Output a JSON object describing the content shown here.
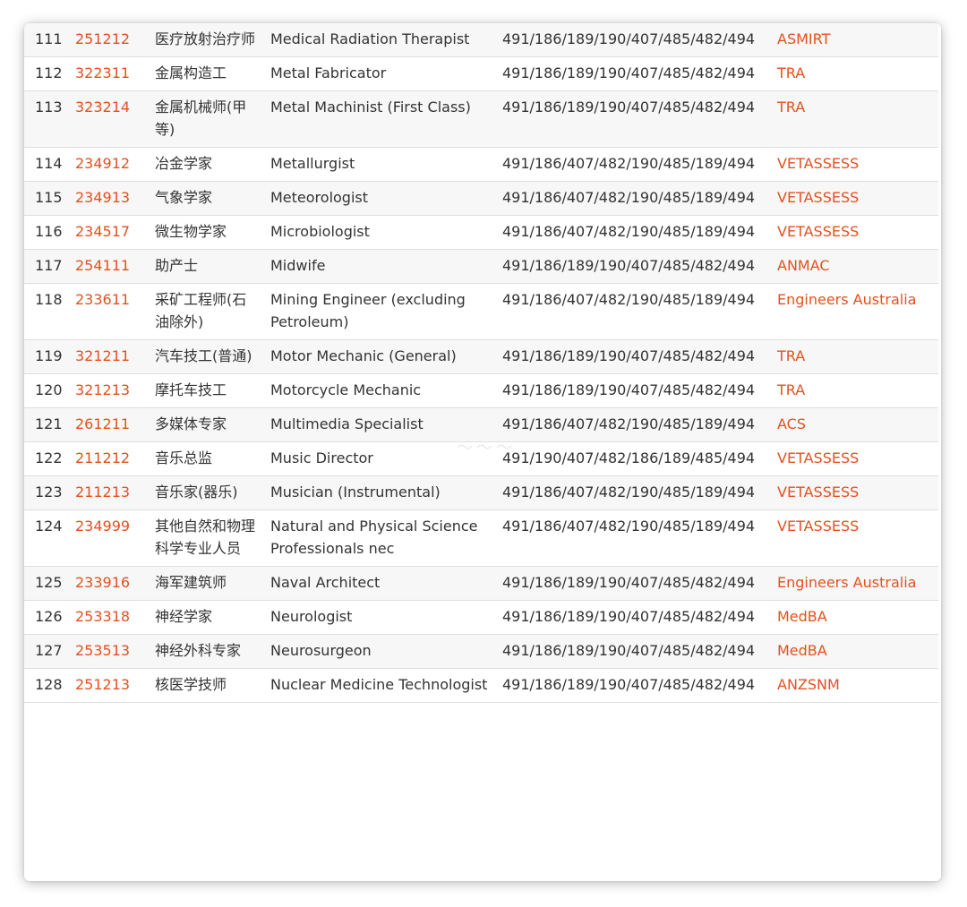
{
  "table": {
    "rows": [
      {
        "idx": "111",
        "code": "251212",
        "cn": "医疗放射治疗师",
        "en": "Medical Radiation Therapist",
        "visa": "491/186/189/190/407/485/482/494",
        "authority": "ASMIRT"
      },
      {
        "idx": "112",
        "code": "322311",
        "cn": "金属构造工",
        "en": "Metal Fabricator",
        "visa": "491/186/189/190/407/485/482/494",
        "authority": "TRA"
      },
      {
        "idx": "113",
        "code": "323214",
        "cn": "金属机械师(甲等)",
        "en": "Metal Machinist (First Class)",
        "visa": "491/186/189/190/407/485/482/494",
        "authority": "TRA"
      },
      {
        "idx": "114",
        "code": "234912",
        "cn": "冶金学家",
        "en": "Metallurgist",
        "visa": "491/186/407/482/190/485/189/494",
        "authority": "VETASSESS"
      },
      {
        "idx": "115",
        "code": "234913",
        "cn": "气象学家",
        "en": "Meteorologist",
        "visa": "491/186/407/482/190/485/189/494",
        "authority": "VETASSESS"
      },
      {
        "idx": "116",
        "code": "234517",
        "cn": "微生物学家",
        "en": "Microbiologist",
        "visa": "491/186/407/482/190/485/189/494",
        "authority": "VETASSESS"
      },
      {
        "idx": "117",
        "code": "254111",
        "cn": "助产士",
        "en": "Midwife",
        "visa": "491/186/189/190/407/485/482/494",
        "authority": "ANMAC"
      },
      {
        "idx": "118",
        "code": "233611",
        "cn": "采矿工程师(石油除外)",
        "en": "Mining Engineer (excluding Petroleum)",
        "visa": "491/186/407/482/190/485/189/494",
        "authority": "Engineers Australia"
      },
      {
        "idx": "119",
        "code": "321211",
        "cn": "汽车技工(普通)",
        "en": "Motor Mechanic (General)",
        "visa": "491/186/189/190/407/485/482/494",
        "authority": "TRA"
      },
      {
        "idx": "120",
        "code": "321213",
        "cn": "摩托车技工",
        "en": "Motorcycle Mechanic",
        "visa": "491/186/189/190/407/485/482/494",
        "authority": "TRA"
      },
      {
        "idx": "121",
        "code": "261211",
        "cn": "多媒体专家",
        "en": "Multimedia Specialist",
        "visa": "491/186/407/482/190/485/189/494",
        "authority": "ACS"
      },
      {
        "idx": "122",
        "code": "211212",
        "cn": "音乐总监",
        "en": "Music Director",
        "visa": "491/190/407/482/186/189/485/494",
        "authority": "VETASSESS"
      },
      {
        "idx": "123",
        "code": "211213",
        "cn": "音乐家(器乐)",
        "en": "Musician (Instrumental)",
        "visa": "491/186/407/482/190/485/189/494",
        "authority": "VETASSESS"
      },
      {
        "idx": "124",
        "code": "234999",
        "cn": "其他自然和物理科学专业人员",
        "en": "Natural and Physical Science Professionals nec",
        "visa": "491/186/407/482/190/485/189/494",
        "authority": "VETASSESS"
      },
      {
        "idx": "125",
        "code": "233916",
        "cn": "海军建筑师",
        "en": "Naval Architect",
        "visa": "491/186/189/190/407/485/482/494",
        "authority": "Engineers Australia"
      },
      {
        "idx": "126",
        "code": "253318",
        "cn": "神经学家",
        "en": "Neurologist",
        "visa": "491/186/189/190/407/485/482/494",
        "authority": "MedBA"
      },
      {
        "idx": "127",
        "code": "253513",
        "cn": "神经外科专家",
        "en": "Neurosurgeon",
        "visa": "491/186/189/190/407/485/482/494",
        "authority": "MedBA"
      },
      {
        "idx": "128",
        "code": "251213",
        "cn": "核医学技师",
        "en": "Nuclear Medicine Technologist",
        "visa": "491/186/189/190/407/485/482/494",
        "authority": "ANZSNM"
      }
    ]
  },
  "colors": {
    "link": "#e5501e",
    "text": "#333333",
    "row_alt": "#f7f7f7"
  }
}
